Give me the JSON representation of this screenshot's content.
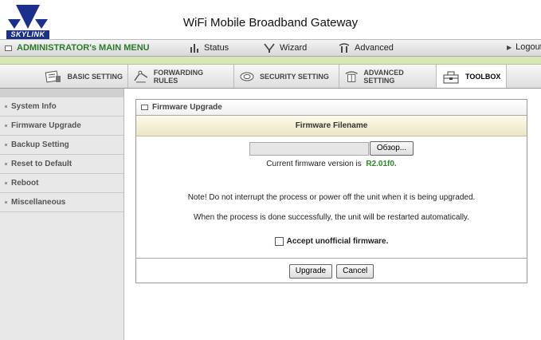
{
  "header": {
    "logo_text": "SKYLINK",
    "title": "WiFi Mobile Broadband Gateway"
  },
  "main_menu": {
    "title": "ADMINISTRATOR's MAIN MENU",
    "items": [
      {
        "label": "Status",
        "icon": "status-icon"
      },
      {
        "label": "Wizard",
        "icon": "wizard-icon"
      },
      {
        "label": "Advanced",
        "icon": "advanced-icon"
      },
      {
        "label": "Logout",
        "icon": "logout-arrow-icon"
      }
    ]
  },
  "toolbar": {
    "items": [
      {
        "label": "BASIC SETTING",
        "icon": "basic-setting-icon"
      },
      {
        "label": "FORWARDING RULES",
        "icon": "forwarding-rules-icon"
      },
      {
        "label": "SECURITY SETTING",
        "icon": "security-setting-icon"
      },
      {
        "label": "ADVANCED SETTING",
        "icon": "advanced-setting-icon"
      },
      {
        "label": "TOOLBOX",
        "icon": "toolbox-icon",
        "active": true
      }
    ]
  },
  "sidebar": {
    "items": [
      {
        "label": "System Info"
      },
      {
        "label": "Firmware Upgrade"
      },
      {
        "label": "Backup Setting"
      },
      {
        "label": "Reset to Default"
      },
      {
        "label": "Reboot"
      },
      {
        "label": "Miscellaneous"
      }
    ]
  },
  "panel": {
    "title": "Firmware Upgrade",
    "column_header": "Firmware Filename",
    "file_input_value": "",
    "browse_label": "Обзор...",
    "current_version_label": "Current firmware version is",
    "current_version": "R2.01f0.",
    "note": "Note! Do not interrupt the process or power off the unit when it is being upgraded.",
    "restart_note": "When the process is done successfully, the unit will be restarted automatically.",
    "accept_label": "Accept unofficial firmware.",
    "accept_checked": false,
    "upgrade_label": "Upgrade",
    "cancel_label": "Cancel"
  },
  "colors": {
    "accent_green": "#2c7a2c",
    "version_green": "#2a8a2a",
    "separator_green": "#d6e8b6"
  }
}
